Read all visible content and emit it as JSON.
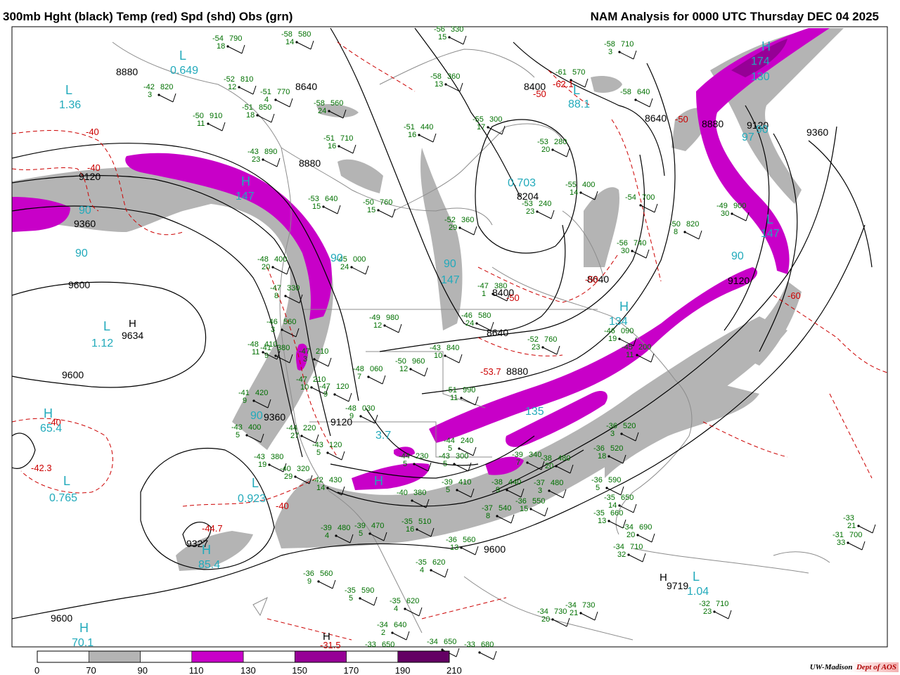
{
  "header": {
    "left_title": "300mb Hght (black) Temp (red) Spd (shd) Obs (grn)",
    "right_title": "NAM Analysis for 0000 UTC Thursday  DEC 04 2025"
  },
  "credit": {
    "org": "UW-Madison",
    "dept": "Dept of AOS"
  },
  "legend": {
    "ticks": [
      "0",
      "70",
      "90",
      "110",
      "130",
      "150",
      "170",
      "190",
      "210"
    ],
    "colors": [
      "#ffffff",
      "#b4b4b4",
      "#ffffff",
      "#c800c8",
      "#ffffff",
      "#960096",
      "#ffffff",
      "#640064"
    ]
  },
  "colors": {
    "height": "#000000",
    "temp": "#cc0000",
    "obs": "#007000",
    "speed_label": "#22aabb",
    "shade_70": "#b4b4b4",
    "shade_110": "#c800c8",
    "shade_150": "#960096",
    "map_lines": "#8c8c8c"
  },
  "height_labels": [
    "8880",
    "9120",
    "9360",
    "9600",
    "9634",
    "9600",
    "8880",
    "8400",
    "8640",
    "8640",
    "8880",
    "9120",
    "9360",
    "8204",
    "8640",
    "9120",
    "8400",
    "8640",
    "8880",
    "9360",
    "9120",
    "9327",
    "9600",
    "9719",
    "9600"
  ],
  "height_centers": [
    "H",
    "H",
    "H"
  ],
  "temp_labels": [
    "-40",
    "-40",
    "-40",
    "-42.3",
    "-44.7",
    "-50",
    "-50",
    "-62.1",
    "-50",
    "-50",
    "-40",
    "-31.5",
    "-53.7",
    "-60"
  ],
  "speed_labels": [
    "0.649",
    "1.36",
    "90",
    "90",
    "147",
    "0.703",
    "90",
    "147",
    "134",
    "135",
    "90",
    "3.7",
    "90",
    "65.4",
    "0.765",
    "0.923",
    "85.4",
    "1.04",
    "70.1",
    "88.1",
    "97",
    "90",
    "174",
    "130",
    "90",
    "147",
    "1.12"
  ],
  "speed_centers": [
    "L",
    "L",
    "L",
    "L",
    "H",
    "H",
    "L",
    "L",
    "H",
    "L",
    "H",
    "H",
    "H",
    "H",
    "L"
  ],
  "obs": [
    {
      "t": "-54",
      "h": "790",
      "s": "18"
    },
    {
      "t": "-58",
      "h": "580",
      "s": "14"
    },
    {
      "t": "-56",
      "h": "330",
      "s": "15"
    },
    {
      "t": "-52",
      "h": "810",
      "s": "12"
    },
    {
      "t": "-42",
      "h": "820",
      "s": "3"
    },
    {
      "t": "-51",
      "h": "770",
      "s": "4"
    },
    {
      "t": "-51",
      "h": "850",
      "s": "18"
    },
    {
      "t": "-50",
      "h": "910",
      "s": "11"
    },
    {
      "t": "-58",
      "h": "560",
      "s": "24"
    },
    {
      "t": "-51",
      "h": "440",
      "s": "16"
    },
    {
      "t": "-58",
      "h": "360",
      "s": "13"
    },
    {
      "t": "-55",
      "h": "300",
      "s": "17"
    },
    {
      "t": "-51",
      "h": "710",
      "s": "16"
    },
    {
      "t": "-43",
      "h": "890",
      "s": "23"
    },
    {
      "t": "-53",
      "h": "280",
      "s": "20"
    },
    {
      "t": "-58",
      "h": "710",
      "s": "3"
    },
    {
      "t": "-61",
      "h": "570",
      "s": ""
    },
    {
      "t": "-58",
      "h": "640",
      "s": ""
    },
    {
      "t": "-53",
      "h": "640",
      "s": "15"
    },
    {
      "t": "-50",
      "h": "760",
      "s": "15"
    },
    {
      "t": "-52",
      "h": "360",
      "s": "29"
    },
    {
      "t": "-55",
      "h": "400",
      "s": "14"
    },
    {
      "t": "-53",
      "h": "240",
      "s": "23"
    },
    {
      "t": "-54",
      "h": "700",
      "s": ""
    },
    {
      "t": "-49",
      "h": "900",
      "s": "30"
    },
    {
      "t": "-50",
      "h": "820",
      "s": "8"
    },
    {
      "t": "-56",
      "h": "740",
      "s": "30"
    },
    {
      "t": "-45",
      "h": "000",
      "s": "24"
    },
    {
      "t": "-48",
      "h": "400",
      "s": "20"
    },
    {
      "t": "-47",
      "h": "380",
      "s": "1"
    },
    {
      "t": "-49",
      "h": "980",
      "s": "12"
    },
    {
      "t": "-46",
      "h": "580",
      "s": "24"
    },
    {
      "t": "-47",
      "h": "330",
      "s": "8"
    },
    {
      "t": "-41",
      "h": "380",
      "s": "9"
    },
    {
      "t": "-46",
      "h": "560",
      "s": "3"
    },
    {
      "t": "-48",
      "h": "410",
      "s": "11"
    },
    {
      "t": "-47",
      "h": "210",
      "s": "3"
    },
    {
      "t": "-43",
      "h": "840",
      "s": "10"
    },
    {
      "t": "-52",
      "h": "760",
      "s": "23"
    },
    {
      "t": "-46",
      "h": "090",
      "s": "19"
    },
    {
      "t": "-45",
      "h": "200",
      "s": "11"
    },
    {
      "t": "-48",
      "h": "060",
      "s": "7"
    },
    {
      "t": "-50",
      "h": "960",
      "s": "12"
    },
    {
      "t": "-47",
      "h": "210",
      "s": "10"
    },
    {
      "t": "-47",
      "h": "120",
      "s": "9"
    },
    {
      "t": "-41",
      "h": "420",
      "s": "9"
    },
    {
      "t": "-51",
      "h": "990",
      "s": "11"
    },
    {
      "t": "-48",
      "h": "030",
      "s": "9"
    },
    {
      "t": "-43",
      "h": "400",
      "s": "5"
    },
    {
      "t": "-44",
      "h": "220",
      "s": "27"
    },
    {
      "t": "-43",
      "h": "120",
      "s": "5"
    },
    {
      "t": "-44",
      "h": "240",
      "s": "5"
    },
    {
      "t": "-43",
      "h": "380",
      "s": "19"
    },
    {
      "t": "-40",
      "h": "320",
      "s": "29"
    },
    {
      "t": "-44",
      "h": "230",
      "s": "5"
    },
    {
      "t": "-43",
      "h": "300",
      "s": "5"
    },
    {
      "t": "-39",
      "h": "340",
      "s": "7"
    },
    {
      "t": "-38",
      "h": "480",
      "s": "20"
    },
    {
      "t": "-42",
      "h": "430",
      "s": "14"
    },
    {
      "t": "-40",
      "h": "380",
      "s": ""
    },
    {
      "t": "-39",
      "h": "410",
      "s": "5"
    },
    {
      "t": "-38",
      "h": "440",
      "s": "9"
    },
    {
      "t": "-37",
      "h": "480",
      "s": "3"
    },
    {
      "t": "-36",
      "h": "520",
      "s": "18"
    },
    {
      "t": "-36",
      "h": "590",
      "s": "5"
    },
    {
      "t": "-39",
      "h": "480",
      "s": "4"
    },
    {
      "t": "-39",
      "h": "470",
      "s": "5"
    },
    {
      "t": "-35",
      "h": "510",
      "s": "16"
    },
    {
      "t": "-37",
      "h": "540",
      "s": "8"
    },
    {
      "t": "-36",
      "h": "550",
      "s": "15"
    },
    {
      "t": "-35",
      "h": "650",
      "s": "14"
    },
    {
      "t": "-35",
      "h": "660",
      "s": "13"
    },
    {
      "t": "-36",
      "h": "560",
      "s": "9"
    },
    {
      "t": "-34",
      "h": "690",
      "s": "20"
    },
    {
      "t": "-34",
      "h": "710",
      "s": "32"
    },
    {
      "t": "-35",
      "h": "620",
      "s": "4"
    },
    {
      "t": "-36",
      "h": "560",
      "s": "13"
    },
    {
      "t": "-35",
      "h": "590",
      "s": "5"
    },
    {
      "t": "-35",
      "h": "620",
      "s": "4"
    },
    {
      "t": "-34",
      "h": "640",
      "s": "2"
    },
    {
      "t": "-33",
      "h": "650",
      "s": ""
    },
    {
      "t": "-34",
      "h": "650",
      "s": ""
    },
    {
      "t": "-33",
      "h": "680",
      "s": ""
    },
    {
      "t": "-34",
      "h": "730",
      "s": "20"
    },
    {
      "t": "-34",
      "h": "730",
      "s": "21"
    },
    {
      "t": "-32",
      "h": "710",
      "s": "23"
    },
    {
      "t": "-31",
      "h": "700",
      "s": "33"
    },
    {
      "t": "-33",
      "h": "",
      "s": "21"
    },
    {
      "t": "-36",
      "h": "520",
      "s": "3"
    }
  ]
}
